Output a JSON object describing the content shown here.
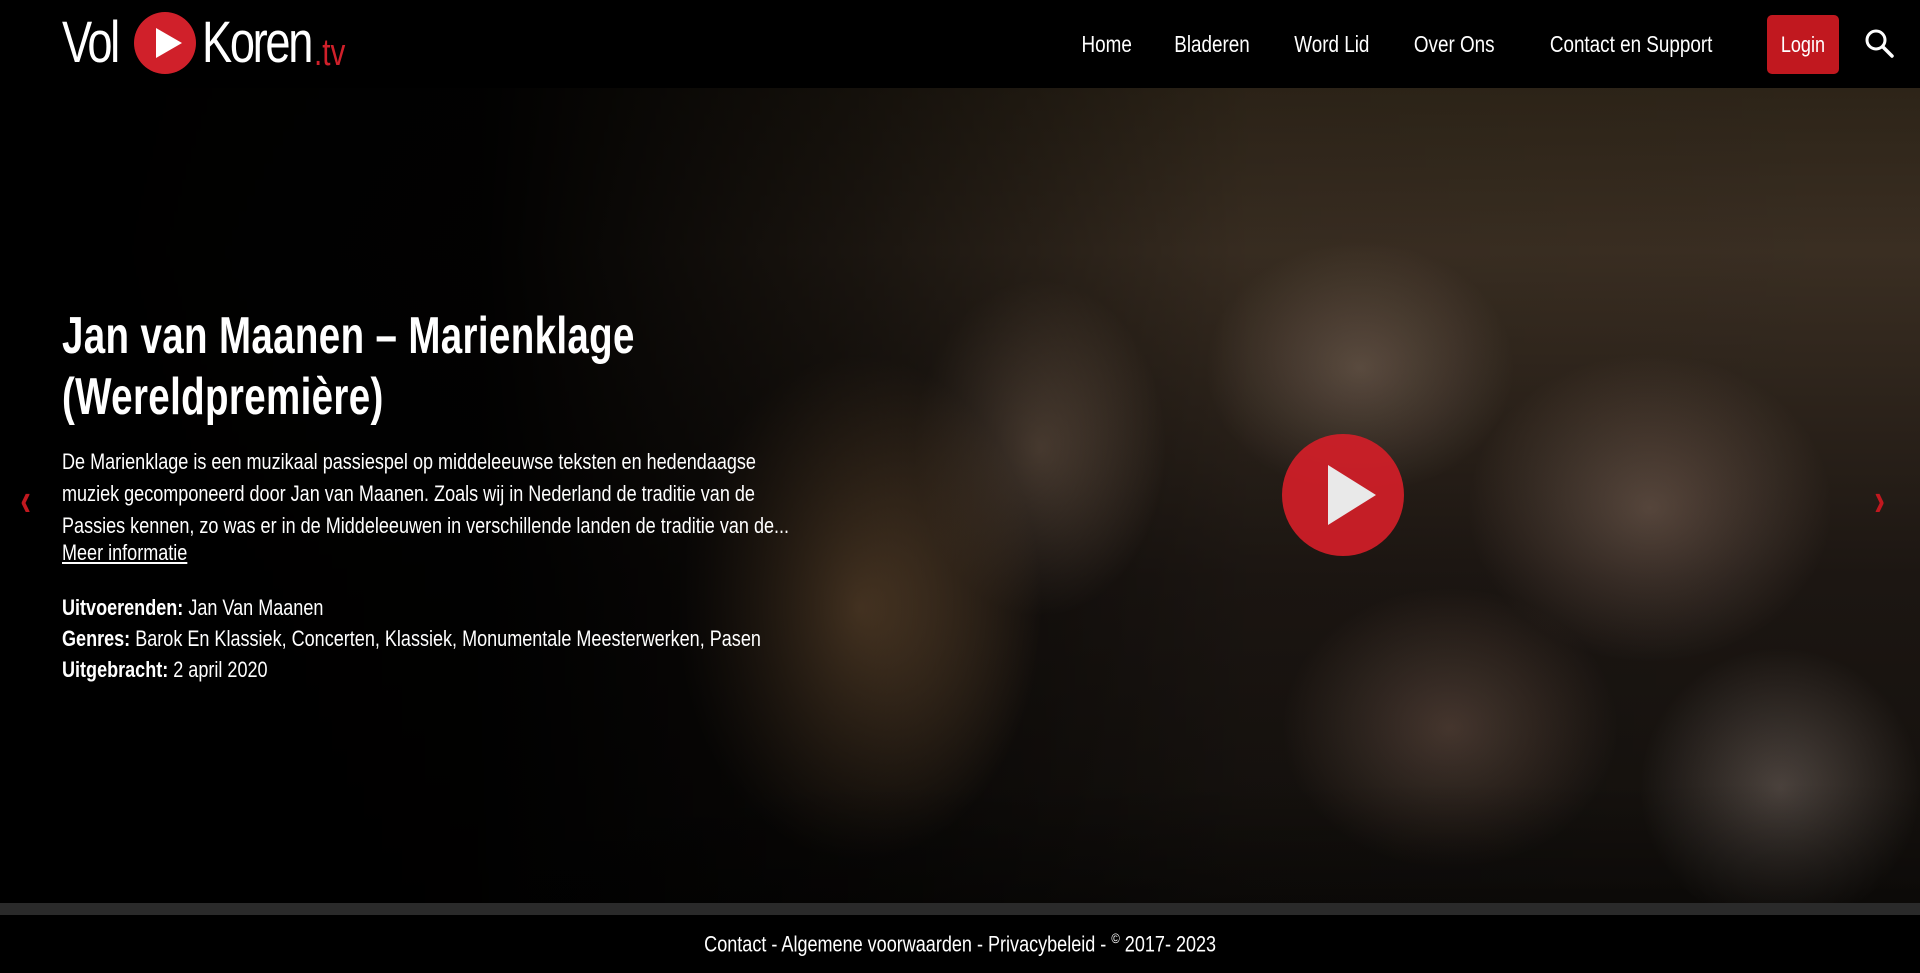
{
  "header": {
    "logo": {
      "word1": "Vol",
      "word2": "Koren",
      "suffix": ".tv"
    },
    "nav": [
      "Home",
      "Bladeren",
      "Word Lid",
      "Over Ons",
      "Contact en Support"
    ],
    "login_label": "Login",
    "search_icon": "search-icon"
  },
  "hero": {
    "title_line1": "Jan van Maanen – Marienklage",
    "title_line2": "(Wereldpremière)",
    "description": "De Marienklage is een muzikaal passiespel op middeleeuwse teksten en hedendaagse muziek gecomponeerd door Jan van Maanen. Zoals wij in Nederland de traditie van de Passies kennen, zo was er in de Middeleeuwen in verschillende landen de traditie van de...",
    "more_link": "Meer informatie",
    "performers_label": "Uitvoerenden:",
    "performers_value": "Jan Van Maanen",
    "genres_label": "Genres:",
    "genres_value": "Barok En Klassiek, Concerten, Klassiek, Monumentale Meesterwerken, Pasen",
    "released_label": "Uitgebracht:",
    "released_value": "2 april 2020",
    "prev_arrow": "‹",
    "next_arrow": "›"
  },
  "footer": {
    "contact": "Contact",
    "terms": "Algemene voorwaarden",
    "privacy": "Privacybeleid",
    "sep": " - ",
    "copyright_symbol": "©",
    "years": " 2017- 2023"
  },
  "colors": {
    "accent": "#c1181f",
    "background": "#000000"
  }
}
